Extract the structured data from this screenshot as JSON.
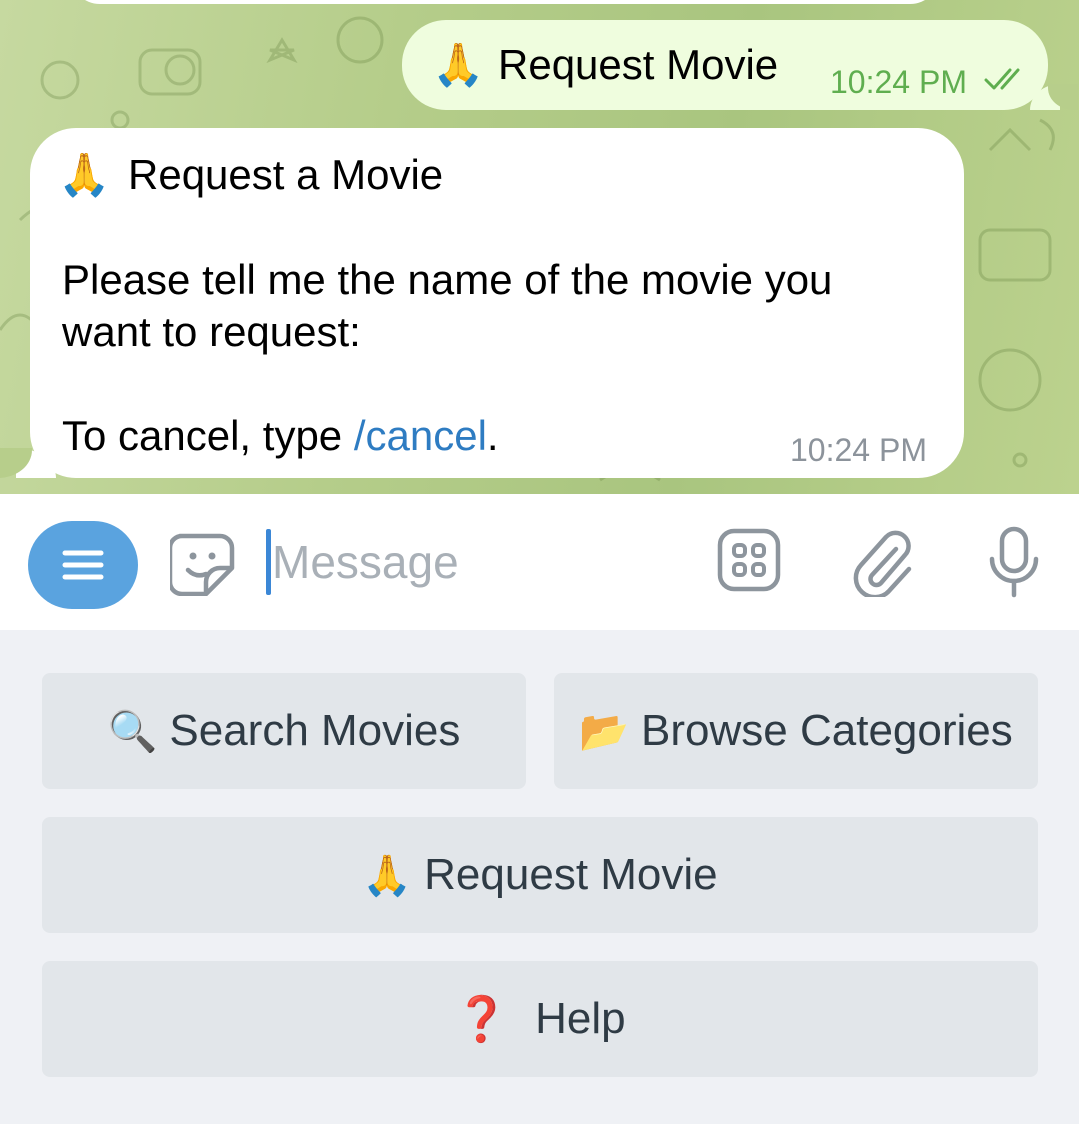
{
  "messages": {
    "outgoing": {
      "emoji": "🙏",
      "text": "Request Movie",
      "time": "10:24 PM",
      "status_icon": "double-check-icon"
    },
    "incoming": {
      "emoji": "🙏",
      "title": "Request a Movie",
      "body_line1": "Please tell me the name of the movie you",
      "body_line2": "want to request:",
      "cancel_prefix": "To cancel, type ",
      "cancel_command": "/cancel",
      "cancel_suffix": ".",
      "time": "10:24 PM"
    }
  },
  "composer": {
    "placeholder": "Message",
    "menu_icon": "menu-icon",
    "sticker_icon": "sticker-icon",
    "commands_icon": "bot-keyboard-icon",
    "attach_icon": "paperclip-icon",
    "mic_icon": "microphone-icon"
  },
  "keyboard": {
    "search": {
      "emoji": "🔍",
      "label": "Search Movies"
    },
    "browse": {
      "emoji": "📂",
      "label": "Browse Categories"
    },
    "request": {
      "emoji": "🙏",
      "label": "Request Movie"
    },
    "help": {
      "emoji": "❓",
      "label": "Help"
    }
  },
  "colors": {
    "accent": "#5aa3df",
    "link": "#2e7cc2",
    "outgoing_bubble": "#effdde",
    "outgoing_time": "#5fae4f",
    "chat_background": "#b7ce8b",
    "keyboard_button": "#e2e6ea"
  }
}
